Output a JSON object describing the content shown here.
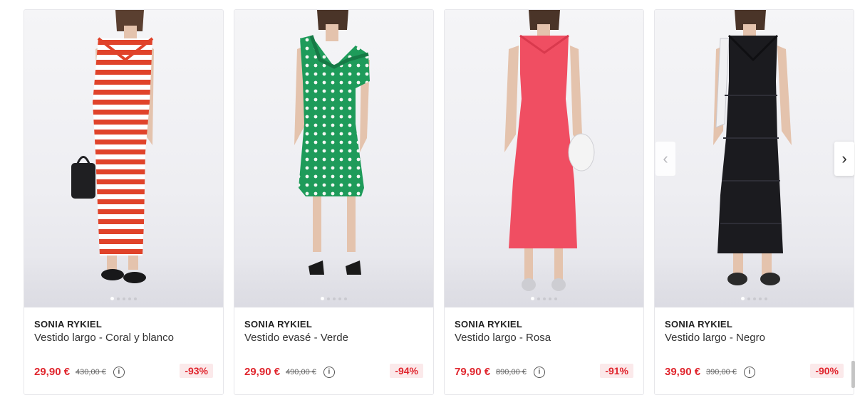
{
  "products": [
    {
      "brand": "SONIA RYKIEL",
      "title": "Vestido largo - Coral y blanco",
      "price": "29,90 €",
      "old_price": "430,00 €",
      "discount": "-93%",
      "dress_color": "coral and white stripes"
    },
    {
      "brand": "SONIA RYKIEL",
      "title": "Vestido evasé - Verde",
      "price": "29,90 €",
      "old_price": "490,00 €",
      "discount": "-94%",
      "dress_color": "green polka dot"
    },
    {
      "brand": "SONIA RYKIEL",
      "title": "Vestido largo - Rosa",
      "price": "79,90 €",
      "old_price": "890,00 €",
      "discount": "-91%",
      "dress_color": "pink crochet"
    },
    {
      "brand": "SONIA RYKIEL",
      "title": "Vestido largo - Negro",
      "price": "39,90 €",
      "old_price": "390,00 €",
      "discount": "-90%",
      "dress_color": "black knit"
    }
  ],
  "icons": {
    "info": "info-circle-icon",
    "prev": "chevron-left-icon",
    "next": "chevron-right-icon"
  },
  "colors": {
    "price": "#e0262e",
    "discount_bg": "#fbe9ea",
    "coral": "#e0432a",
    "green": "#1e9b5a",
    "pink": "#f04e62",
    "black": "#1b1b1f"
  }
}
